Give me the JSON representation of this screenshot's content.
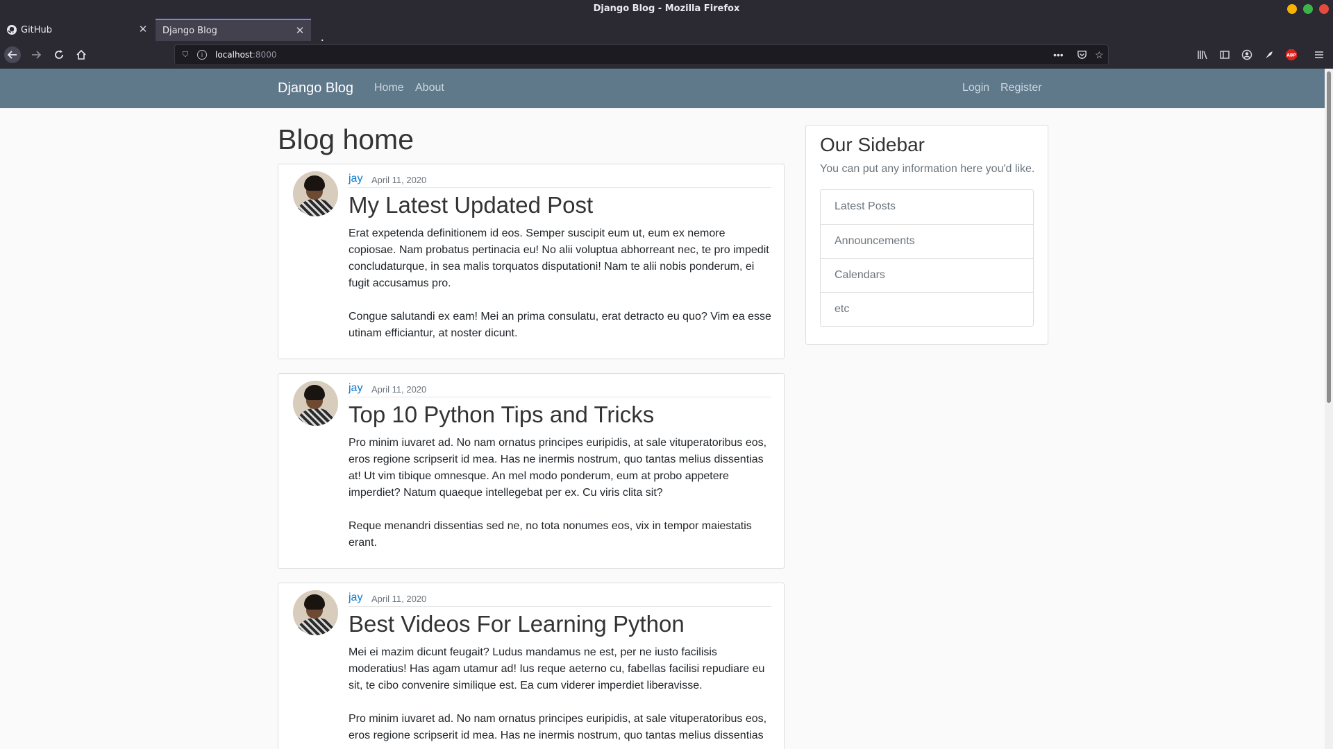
{
  "browser": {
    "window_title": "Django Blog - Mozilla Firefox",
    "tabs": [
      {
        "label": "GitHub",
        "icon": "github-icon"
      },
      {
        "label": "Django Blog",
        "active": true
      }
    ],
    "url_host": "localhost",
    "url_port": ":8000",
    "window_buttons": {
      "minimize": "#f5b400",
      "maximize": "#3bb54a",
      "close": "#e54b3c"
    }
  },
  "site": {
    "brand": "Django Blog",
    "nav_left": [
      "Home",
      "About"
    ],
    "nav_right": [
      "Login",
      "Register"
    ],
    "header_color": "#5f788a",
    "link_color": "#0b7ad0"
  },
  "main": {
    "page_title": "Blog home",
    "posts": [
      {
        "author": "jay",
        "date": "April 11, 2020",
        "title": "My Latest Updated Post",
        "paragraphs": [
          "Erat expetenda definitionem id eos. Semper suscipit eum ut, eum ex nemore copiosae. Nam probatus pertinacia eu! No alii voluptua abhorreant nec, te pro impedit concludaturque, in sea malis torquatos disputationi! Nam te alii nobis ponderum, ei fugit accusamus pro.",
          "Congue salutandi ex eam! Mei an prima consulatu, erat detracto eu quo? Vim ea esse utinam efficiantur, at noster dicunt."
        ]
      },
      {
        "author": "jay",
        "date": "April 11, 2020",
        "title": "Top 10 Python Tips and Tricks",
        "paragraphs": [
          "Pro minim iuvaret ad. No nam ornatus principes euripidis, at sale vituperatoribus eos, eros regione scripserit id mea. Has ne inermis nostrum, quo tantas melius dissentias at! Ut vim tibique omnesque. An mel modo ponderum, eum at probo appetere imperdiet? Natum quaeque intellegebat per ex. Cu viris clita sit?",
          "Reque menandri dissentias sed ne, no tota nonumes eos, vix in tempor maiestatis erant."
        ]
      },
      {
        "author": "jay",
        "date": "April 11, 2020",
        "title": "Best Videos For Learning Python",
        "paragraphs": [
          "Mei ei mazim dicunt feugait? Ludus mandamus ne est, per ne iusto facilisis moderatius! Has agam utamur ad! Ius reque aeterno cu, fabellas facilisi repudiare eu sit, te cibo convenire similique est. Ea cum viderer imperdiet liberavisse.",
          "Pro minim iuvaret ad. No nam ornatus principes euripidis, at sale vituperatoribus eos, eros regione scripserit id mea. Has ne inermis nostrum, quo tantas melius dissentias"
        ]
      }
    ]
  },
  "sidebar": {
    "title": "Our Sidebar",
    "text": "You can put any information here you'd like.",
    "items": [
      "Latest Posts",
      "Announcements",
      "Calendars",
      "etc"
    ]
  }
}
